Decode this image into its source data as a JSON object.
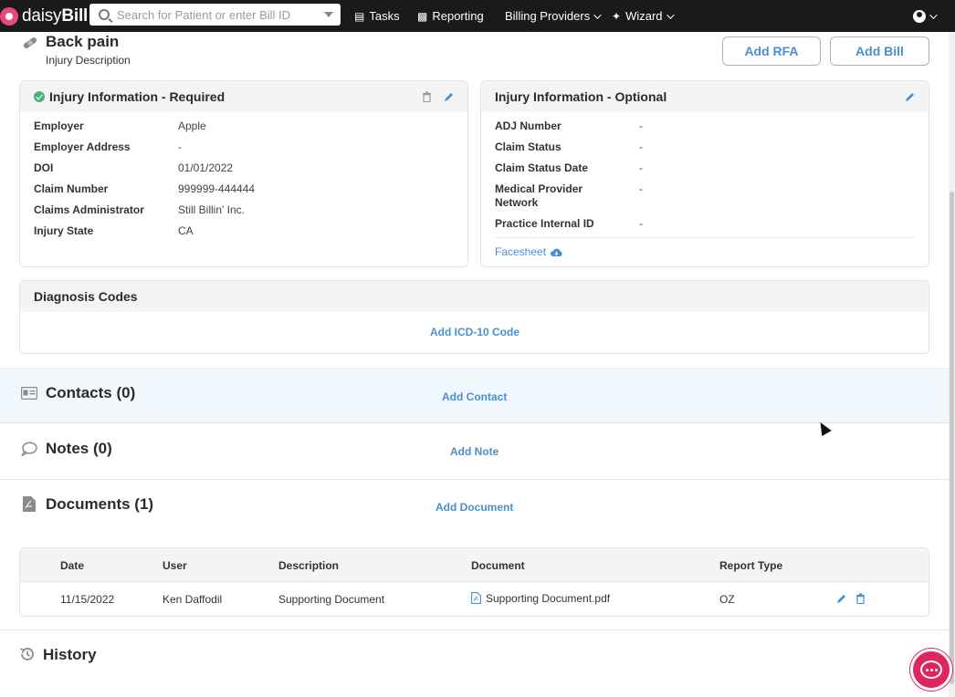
{
  "nav": {
    "brand_prefix": "daisy",
    "brand_suffix": "Bill",
    "search_placeholder": "Search for Patient or enter Bill ID",
    "items": [
      {
        "label": "Tasks",
        "icon": "clipboard-icon"
      },
      {
        "label": "Reporting",
        "icon": "bar-chart-icon"
      },
      {
        "label": "Billing Providers",
        "icon": "chevron-down-icon"
      },
      {
        "label": "Wizard",
        "icon": "wand-icon"
      }
    ]
  },
  "header": {
    "title": "Back pain",
    "subtitle": "Injury Description",
    "add_rfa": "Add RFA",
    "add_bill": "Add Bill"
  },
  "required": {
    "title": "Injury Information - Required",
    "rows": [
      {
        "label": "Employer",
        "value": "Apple"
      },
      {
        "label": "Employer Address",
        "value": "-"
      },
      {
        "label": "DOI",
        "value": "01/01/2022"
      },
      {
        "label": "Claim Number",
        "value": "999999-444444"
      },
      {
        "label": "Claims Administrator",
        "value": "Still Billin' Inc."
      },
      {
        "label": "Injury State",
        "value": "CA"
      }
    ]
  },
  "optional": {
    "title": "Injury Information - Optional",
    "rows": [
      {
        "label": "ADJ Number",
        "value": "-"
      },
      {
        "label": "Claim Status",
        "value": "-"
      },
      {
        "label": "Claim Status Date",
        "value": "-"
      },
      {
        "label": "Medical Provider Network",
        "value": "-"
      },
      {
        "label": "Practice Internal ID",
        "value": "-"
      }
    ],
    "facesheet": "Facesheet"
  },
  "diagnosis": {
    "title": "Diagnosis Codes",
    "add_label": "Add ICD-10 Code"
  },
  "contacts": {
    "title": "Contacts (0)",
    "add_label": "Add Contact"
  },
  "notes": {
    "title": "Notes (0)",
    "add_label": "Add Note"
  },
  "documents": {
    "title": "Documents (1)",
    "add_label": "Add Document",
    "columns": [
      "Date",
      "User",
      "Description",
      "Document",
      "Report Type"
    ],
    "rows": [
      {
        "date": "11/15/2022",
        "user": "Ken Daffodil",
        "description": "Supporting Document",
        "document": "Supporting Document.pdf",
        "report_type": "OZ"
      }
    ]
  },
  "history": {
    "title": "History"
  },
  "colors": {
    "accent": "#4a8fcf",
    "nav_bg": "#1a1a1a",
    "brand_pink": "#e9487e",
    "chat_red": "#e0245e",
    "success": "#4caf80"
  }
}
